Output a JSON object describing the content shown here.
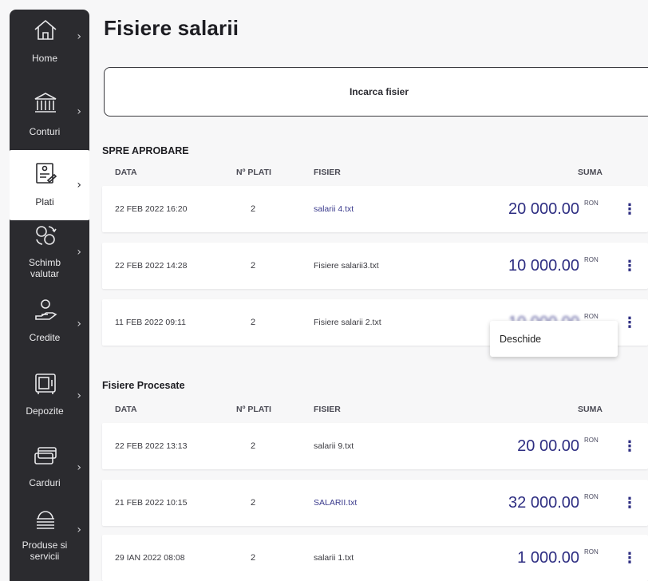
{
  "nav": {
    "items": [
      {
        "label_line1": "Home",
        "label_line2": "",
        "icon": "home-icon"
      },
      {
        "label_line1": "Conturi",
        "label_line2": "",
        "icon": "bank-icon"
      },
      {
        "label_line1": "Plati",
        "label_line2": "",
        "icon": "payments-icon"
      },
      {
        "label_line1": "Schimb",
        "label_line2": "valutar",
        "icon": "currency-exchange-icon"
      },
      {
        "label_line1": "Credite",
        "label_line2": "",
        "icon": "credit-icon"
      },
      {
        "label_line1": "Depozite",
        "label_line2": "",
        "icon": "safe-icon"
      },
      {
        "label_line1": "Carduri",
        "label_line2": "",
        "icon": "cards-icon"
      },
      {
        "label_line1": "Produse si",
        "label_line2": "servicii",
        "icon": "products-icon"
      }
    ],
    "chevron": "›",
    "active": "Plati"
  },
  "page": {
    "title": "Fisiere salarii",
    "upload_label": "Incarca fisier"
  },
  "sections": {
    "pending": {
      "title": "SPRE APROBARE",
      "columns": {
        "date": "DATA",
        "count": "Nº PLATI",
        "file": "FISIER",
        "amount": "SUMA"
      },
      "rows": [
        {
          "date": "22 FEB 2022 16:20",
          "count": "2",
          "file": "salarii 4.txt",
          "amount": "20 000.00",
          "currency": "RON"
        },
        {
          "date": "22 FEB 2022 14:28",
          "count": "2",
          "file": "Fisiere salarii3.txt",
          "amount": "10 000.00",
          "currency": "RON"
        },
        {
          "date": "11 FEB 2022 09:11",
          "count": "2",
          "file": "Fisiere salarii 2.txt",
          "amount": "10 000.00",
          "currency": "RON"
        }
      ]
    },
    "processed": {
      "title": "Fisiere Procesate",
      "columns": {
        "date": "DATA",
        "count": "Nº PLATI",
        "file": "FISIER",
        "amount": "SUMA"
      },
      "rows": [
        {
          "date": "22 FEB 2022 13:13",
          "count": "2",
          "file": "salarii 9.txt",
          "amount": "20 00.00",
          "currency": "RON"
        },
        {
          "date": "21 FEB 2022 10:15",
          "count": "2",
          "file": "SALARII.txt",
          "amount": "32 000.00",
          "currency": "RON"
        },
        {
          "date": "29 IAN 2022 08:08",
          "count": "2",
          "file": "salarii 1.txt",
          "amount": "1 000.00",
          "currency": "RON"
        }
      ]
    }
  },
  "kebab": "⋮",
  "context_menu": {
    "open_label": "Deschide"
  },
  "colors": {
    "sidebar": "#2b2b2f",
    "accent": "#2e2e82",
    "background": "#f7f7f8"
  }
}
